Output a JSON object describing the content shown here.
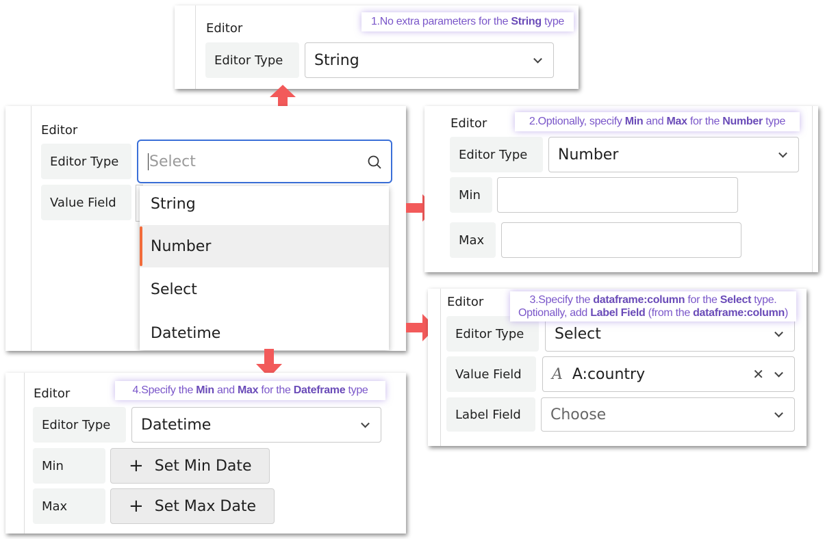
{
  "panel_string": {
    "section": "Editor",
    "editor_type_label": "Editor Type",
    "editor_type_value": "String",
    "callout_pre": "1.No extra parameters for the ",
    "callout_b1": "String",
    "callout_post": " type"
  },
  "panel_main": {
    "section": "Editor",
    "editor_type_label": "Editor Type",
    "search_placeholder": "Select",
    "value_field_label": "Value Field",
    "options": [
      "String",
      "Number",
      "Select",
      "Datetime"
    ],
    "highlighted_option": "Number"
  },
  "panel_number": {
    "section": "Editor",
    "editor_type_label": "Editor Type",
    "editor_type_value": "Number",
    "min_label": "Min",
    "max_label": "Max",
    "callout": [
      "2.Optionally, specify ",
      "Min",
      " and ",
      "Max",
      " for the ",
      "Number",
      " type"
    ]
  },
  "panel_select": {
    "section": "Editor",
    "editor_type_label": "Editor Type",
    "editor_type_value": "Select",
    "value_field_label": "Value Field",
    "value_field_value": "A:country",
    "label_field_label": "Label Field",
    "label_field_placeholder": "Choose",
    "callout_line1": [
      "3.Specify the ",
      "dataframe:column",
      " for the ",
      "Select",
      " type."
    ],
    "callout_line2": [
      "Optionally, add ",
      "Label Field",
      " (from the ",
      "dataframe:column",
      ")"
    ]
  },
  "panel_datetime": {
    "section": "Editor",
    "editor_type_label": "Editor Type",
    "editor_type_value": "Datetime",
    "min_label": "Min",
    "max_label": "Max",
    "set_min": "Set Min Date",
    "set_max": "Set Max Date",
    "callout": [
      "4.Specify the ",
      "Min",
      " and ",
      "Max",
      " for the ",
      "Dateframe",
      " type"
    ]
  },
  "colors": {
    "arrow": "#f25a5a",
    "focus": "#3a6fd8",
    "highlight_bar": "#f26b3a",
    "callout_text": "#7a56c9"
  }
}
